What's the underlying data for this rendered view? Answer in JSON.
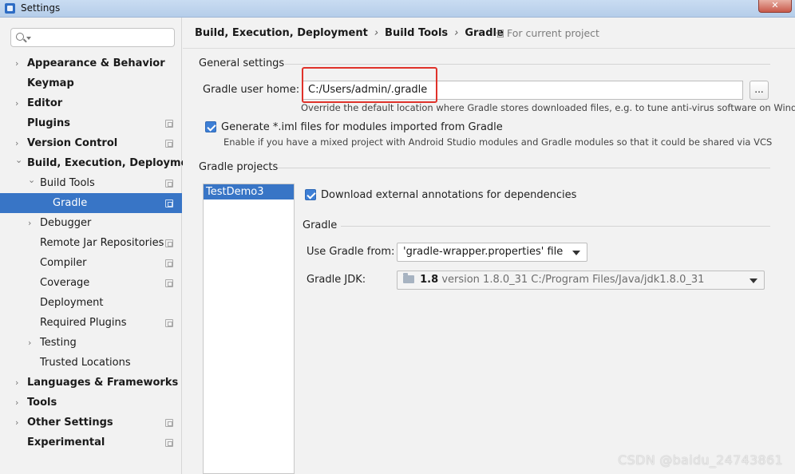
{
  "window": {
    "title": "Settings",
    "close_glyph": "✕"
  },
  "search": {
    "placeholder": ""
  },
  "sidebar": {
    "items": [
      {
        "label": "Appearance & Behavior",
        "bold": true,
        "arrow": "right",
        "level": 0,
        "project": false
      },
      {
        "label": "Keymap",
        "bold": true,
        "arrow": "none",
        "level": 0,
        "project": false
      },
      {
        "label": "Editor",
        "bold": true,
        "arrow": "right",
        "level": 0,
        "project": false
      },
      {
        "label": "Plugins",
        "bold": true,
        "arrow": "none",
        "level": 0,
        "project": true
      },
      {
        "label": "Version Control",
        "bold": true,
        "arrow": "right",
        "level": 0,
        "project": true
      },
      {
        "label": "Build, Execution, Deployment",
        "bold": true,
        "arrow": "down",
        "level": 0,
        "project": false
      },
      {
        "label": "Build Tools",
        "bold": false,
        "arrow": "down",
        "level": 1,
        "project": true
      },
      {
        "label": "Gradle",
        "bold": false,
        "arrow": "none",
        "level": 2,
        "project": true,
        "selected": true
      },
      {
        "label": "Debugger",
        "bold": false,
        "arrow": "right",
        "level": 1,
        "project": false
      },
      {
        "label": "Remote Jar Repositories",
        "bold": false,
        "arrow": "none",
        "level": 1,
        "project": true
      },
      {
        "label": "Compiler",
        "bold": false,
        "arrow": "none",
        "level": 1,
        "project": true
      },
      {
        "label": "Coverage",
        "bold": false,
        "arrow": "none",
        "level": 1,
        "project": true
      },
      {
        "label": "Deployment",
        "bold": false,
        "arrow": "none",
        "level": 1,
        "project": false
      },
      {
        "label": "Required Plugins",
        "bold": false,
        "arrow": "none",
        "level": 1,
        "project": true
      },
      {
        "label": "Testing",
        "bold": false,
        "arrow": "right",
        "level": 1,
        "project": false
      },
      {
        "label": "Trusted Locations",
        "bold": false,
        "arrow": "none",
        "level": 1,
        "project": false
      },
      {
        "label": "Languages & Frameworks",
        "bold": true,
        "arrow": "right",
        "level": 0,
        "project": false
      },
      {
        "label": "Tools",
        "bold": true,
        "arrow": "right",
        "level": 0,
        "project": false
      },
      {
        "label": "Other Settings",
        "bold": true,
        "arrow": "right",
        "level": 0,
        "project": true
      },
      {
        "label": "Experimental",
        "bold": true,
        "arrow": "none",
        "level": 0,
        "project": true
      }
    ]
  },
  "breadcrumb": {
    "items": [
      "Build, Execution, Deployment",
      "Build Tools",
      "Gradle"
    ],
    "separator": "›",
    "scope_note": "For current project"
  },
  "general_settings": {
    "title": "General settings",
    "gradle_home_label": "Gradle user home:",
    "gradle_home_value": "C:/Users/admin/.gradle",
    "browse_label": "...",
    "gradle_home_hint": "Override the default location where Gradle stores downloaded files, e.g. to tune anti-virus software on Windows",
    "generate_iml_label": "Generate *.iml files for modules imported from Gradle",
    "generate_iml_checked": true,
    "generate_iml_hint": "Enable if you have a mixed project with Android Studio modules and Gradle modules so that it could be shared via VCS"
  },
  "gradle_projects": {
    "title": "Gradle projects",
    "projects": [
      "TestDemo3"
    ],
    "download_annotations_label": "Download external annotations for dependencies",
    "download_annotations_checked": true,
    "gradle_group_title": "Gradle",
    "use_gradle_from_label": "Use Gradle from:",
    "use_gradle_from_value": "'gradle-wrapper.properties' file",
    "gradle_jdk_label": "Gradle JDK:",
    "gradle_jdk_version": "1.8",
    "gradle_jdk_detail": "version 1.8.0_31 C:/Program Files/Java/jdk1.8.0_31"
  },
  "watermark": "CSDN @baidu_24743861",
  "colors": {
    "selection": "#3875c6",
    "highlight_box": "#e0322a",
    "checkbox": "#3d7fd6"
  }
}
